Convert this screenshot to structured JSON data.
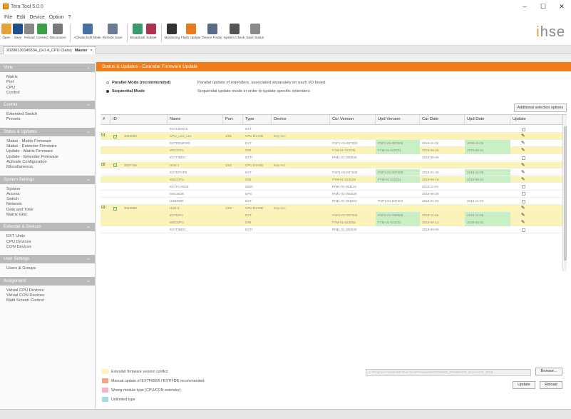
{
  "window": {
    "title": "Tera Tool 5.0.0"
  },
  "menu": [
    "File",
    "Edit",
    "Device",
    "Option",
    "?"
  ],
  "toolbar": {
    "items": [
      {
        "label": "Open",
        "icon": "folder-icon",
        "color": "#e8a23a"
      },
      {
        "label": "Save",
        "icon": "save-icon",
        "color": "#1f4e8c"
      },
      {
        "label": "Reload",
        "icon": "reload-icon",
        "color": "#888888"
      },
      {
        "label": "Connect",
        "icon": "connect-icon",
        "color": "#3aa14a"
      },
      {
        "label": "Disconnect",
        "icon": "disconnect-icon",
        "color": "#777777"
      },
      {
        "label": "Activate Edit Mode",
        "icon": "edit-mode-icon",
        "color": "#4a6fa5"
      },
      {
        "label": "Remote Save",
        "icon": "remote-save-icon",
        "color": "#6b7b93"
      },
      {
        "label": "Broadcast",
        "icon": "broadcast-icon",
        "color": "#3a9a6a"
      },
      {
        "label": "Subset",
        "icon": "subset-icon",
        "color": "#b03050"
      },
      {
        "label": "Monitoring",
        "icon": "monitoring-icon",
        "color": "#333333"
      },
      {
        "label": "Flash Update",
        "icon": "flash-update-icon",
        "color": "#e87b1a"
      },
      {
        "label": "Device Finder",
        "icon": "device-finder-icon",
        "color": "#5a6b85"
      },
      {
        "label": "System Check",
        "icon": "system-check-icon",
        "color": "#555555"
      },
      {
        "label": "Save Status",
        "icon": "save-status-icon",
        "color": "#8a8a8a"
      }
    ]
  },
  "logo": {
    "prefix": "i",
    "text": "hse"
  },
  "tab": {
    "label": "20200130145534_(0.0.4_CPU Class)",
    "flag": "Master",
    "close": "×"
  },
  "sidebar": {
    "sections": [
      {
        "title": "View",
        "items": [
          "Matrix",
          "Port",
          "CPU",
          "Control"
        ]
      },
      {
        "title": "Control",
        "items": [
          "Extended Switch",
          "Presets"
        ]
      },
      {
        "title": "Status & Updates",
        "items": [
          "Status - Matrix Firmware",
          "Status - Extender Firmware",
          "Update - Matrix Firmware",
          "Update - Extender Firmware",
          "Activate Configuration",
          "Miscellaneous"
        ]
      },
      {
        "title": "System Settings",
        "items": [
          "System",
          "Access",
          "Switch",
          "Network",
          "Date and Time",
          "Matrix Grid"
        ]
      },
      {
        "title": "Extender & Devices",
        "items": [
          "EXT Units",
          "CPU Devices",
          "CON Devices"
        ]
      },
      {
        "title": "User Settings",
        "items": [
          "Users & Groups"
        ]
      },
      {
        "title": "Assignment",
        "items": [
          "Virtual CPU Devices",
          "Virtual CON Devices",
          "Multi Screen Control"
        ]
      }
    ]
  },
  "content": {
    "title": "Status & Updates - Extender Firmware Update",
    "modes": [
      {
        "name": "Parallel Mode (recommended)",
        "desc": "Parallel update of extenders, associated separately on each I/O board",
        "selected": false
      },
      {
        "name": "Sequential Mode",
        "desc": "Sequential update mode in order to update specific extenders",
        "selected": true
      }
    ],
    "advanced_button": "Additional selection options",
    "columns": [
      "#",
      "ID",
      "Name",
      "Port",
      "Type",
      "Device",
      "Cur Version",
      "Upd Version",
      "Cur Date",
      "Upd Date",
      "Update"
    ],
    "rows": [
      {
        "num": "",
        "chk": false,
        "id": "",
        "name": "EXTLBV012",
        "port": "",
        "type": "EXT",
        "device": "",
        "cur": "",
        "upd": "",
        "cdate": "",
        "udate": "",
        "update": "checkbox",
        "yellow": false,
        "g1": false,
        "g2": false
      },
      {
        "num": "01",
        "chk": true,
        "id": "3010056",
        "name": "CPU_Lexi_Lex",
        "port": "1/01",
        "type": "CPU DVIHD",
        "device": "Key Acc",
        "cur": "",
        "upd": "",
        "cdate": "",
        "udate": "",
        "update": "pencil",
        "yellow": true,
        "g1": false,
        "g2": false
      },
      {
        "num": "",
        "chk": false,
        "id": "",
        "name": "EXTREMCDS",
        "port": "",
        "type": "EXT",
        "device": "",
        "cur": "PSP1-01-007330",
        "upd": "PSP1-01-007508",
        "cdate": "2018-11-06",
        "udate": "2018-11-06",
        "update": "pencil",
        "yellow": false,
        "g1": true,
        "g2": true
      },
      {
        "num": "",
        "chk": false,
        "id": "",
        "name": "MSCDSU",
        "port": "",
        "type": "DMI",
        "device": "",
        "cur": "FTM-01-010231",
        "upd": "FTM-01-010231",
        "cdate": "2018-05-26",
        "udate": "2018-05-31",
        "update": "pencil",
        "yellow": true,
        "g1": true,
        "g2": true
      },
      {
        "num": "",
        "chk": false,
        "id": "",
        "name": "EXTFIBDC",
        "port": "",
        "type": "EXTI",
        "device": "",
        "cur": "IRM1-01-000040",
        "upd": "",
        "cdate": "2018-06-06",
        "udate": "",
        "update": "checkbox",
        "yellow": false,
        "g1": false,
        "g2": false
      },
      {
        "num": "02",
        "chk": true,
        "id": "3007756",
        "name": "Host 1",
        "port": "1/02",
        "type": "CPU DVIHD",
        "device": "Key Acc",
        "cur": "",
        "upd": "",
        "cdate": "",
        "udate": "",
        "update": "pencil",
        "yellow": true,
        "g1": false,
        "g2": false
      },
      {
        "num": "",
        "chk": false,
        "id": "",
        "name": "EXTDPHPK",
        "port": "",
        "type": "EXT",
        "device": "",
        "cur": "PSP1-01-007330",
        "upd": "PSP1-01-007508",
        "cdate": "2018-01-30",
        "udate": "2018-11-06",
        "update": "pencil",
        "yellow": false,
        "g1": true,
        "g2": true
      },
      {
        "num": "",
        "chk": false,
        "id": "",
        "name": "MSCDPU",
        "port": "",
        "type": "DMI",
        "device": "",
        "cur": "FTM-01-010023",
        "upd": "FTM-01-010231",
        "cdate": "2018-06-18",
        "udate": "2018-05-31",
        "update": "pencil",
        "yellow": true,
        "g1": true,
        "g2": true
      },
      {
        "num": "",
        "chk": false,
        "id": "",
        "name": "EXTFLAKEB",
        "port": "",
        "type": "MISC",
        "device": "",
        "cur": "IRM1-01-001121",
        "upd": "",
        "cdate": "2018-11-01",
        "udate": "",
        "update": "checkbox",
        "yellow": false,
        "g1": false,
        "g2": false
      },
      {
        "num": "",
        "chk": false,
        "id": "",
        "name": "MSCBDB",
        "port": "",
        "type": "DPS",
        "device": "",
        "cur": "IRM1-01-000326",
        "upd": "",
        "cdate": "2018-06-26",
        "udate": "",
        "update": "checkbox",
        "yellow": false,
        "g1": false,
        "g2": false
      },
      {
        "num": "",
        "chk": false,
        "id": "",
        "name": "USBRDR",
        "port": "",
        "type": "EXT",
        "device": "",
        "cur": "IRM1-01-001064",
        "upd": "PSP1-01-007304",
        "cdate": "2018-01-04",
        "udate": "2018-11-04",
        "update": "checkbox",
        "yellow": false,
        "g1": false,
        "g2": false
      },
      {
        "num": "03",
        "chk": true,
        "id": "3010586",
        "name": "Host 3",
        "port": "1/03",
        "type": "CPU DVIHD",
        "device": "Key Acc",
        "cur": "",
        "upd": "",
        "cdate": "",
        "udate": "",
        "update": "pencil",
        "yellow": true,
        "g1": false,
        "g2": false
      },
      {
        "num": "",
        "chk": false,
        "id": "",
        "name": "EXTDPH",
        "port": "",
        "type": "EXT",
        "device": "",
        "cur": "PSP2-01-007330",
        "upd": "PSP2-01-008508",
        "cdate": "2018-11-06",
        "udate": "2018-11-06",
        "update": "pencil",
        "yellow": true,
        "g1": true,
        "g2": true
      },
      {
        "num": "",
        "chk": false,
        "id": "",
        "name": "MSCDPU",
        "port": "",
        "type": "DMI",
        "device": "",
        "cur": "FTM-01-010002",
        "upd": "FTM-01-010231",
        "cdate": "2018-04-13",
        "udate": "2018-05-31",
        "update": "pencil",
        "yellow": true,
        "g1": true,
        "g2": true
      },
      {
        "num": "",
        "chk": false,
        "id": "",
        "name": "EXTFIBDC",
        "port": "",
        "type": "EXTI",
        "device": "",
        "cur": "IRM1-01-000040",
        "upd": "",
        "cdate": "2018-06-06",
        "udate": "",
        "update": "checkbox",
        "yellow": false,
        "g1": false,
        "g2": false
      }
    ],
    "legend": [
      {
        "label": "Extender firmware version conflict",
        "color": "#fbf4b4"
      },
      {
        "label": "Manual update of EXTFIBER / EXTIFDB recommended",
        "color": "#f4a582"
      },
      {
        "label": "Wrong module type (CPU/CON extender)",
        "color": "#f6b3c3"
      },
      {
        "label": "Unlimited type",
        "color": "#9ddde6"
      }
    ],
    "path": "C:\\Program Files\\IHSE\\Tera Tool\\Firmware\\EXTENDER_FIRMWARE_PACKAGE_2019",
    "browse_button": "Browse...",
    "update_button": "Update",
    "reload_button": "Reload"
  }
}
